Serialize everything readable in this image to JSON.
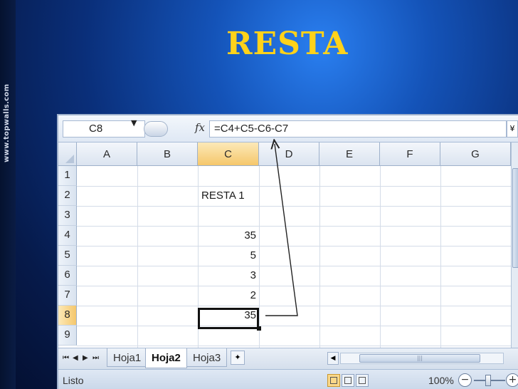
{
  "slide": {
    "title": "RESTA",
    "watermark": "www.topwalls.com",
    "title_color": "#ffd21a"
  },
  "excel": {
    "name_box": "C8",
    "fx_icon_label": "fx",
    "formula": "=C4+C5-C6-C7",
    "columns": [
      "A",
      "B",
      "C",
      "D",
      "E",
      "F",
      "G"
    ],
    "active_column": "C",
    "rows": [
      "1",
      "2",
      "3",
      "4",
      "5",
      "6",
      "7",
      "8",
      "9"
    ],
    "active_row": "8",
    "cells": {
      "C2": "RESTA 1",
      "C4": "35",
      "C5": "5",
      "C6": "3",
      "C7": "2",
      "C8": "35"
    },
    "selected_cell": "C8",
    "sheet_nav": [
      "⏮",
      "◀",
      "▶",
      "⏭"
    ],
    "sheets": [
      "Hoja1",
      "Hoja2",
      "Hoja3"
    ],
    "active_sheet": "Hoja2",
    "status": "Listo",
    "zoom": "100%",
    "zoom_minus": "−",
    "zoom_plus": "+"
  }
}
